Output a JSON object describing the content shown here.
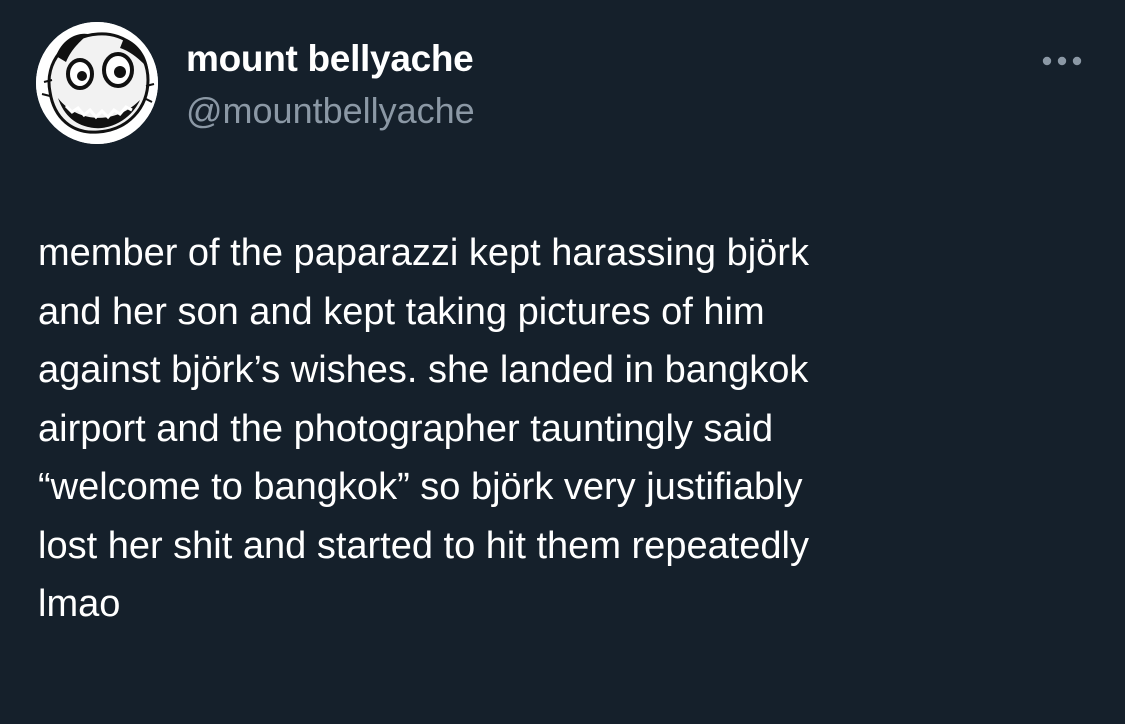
{
  "colors": {
    "background": "#15202b",
    "text_primary": "#ffffff",
    "text_secondary": "#8b98a5"
  },
  "author": {
    "avatar_icon": "cartoon-face-avatar",
    "display_name": "mount bellyache",
    "handle": "@mountbellyache"
  },
  "header": {
    "more_icon": "more-horizontal-icon"
  },
  "tweet": {
    "text_lines": [
      "member of the paparazzi kept harassing björk",
      "and her son and kept taking pictures of him",
      "against björk’s wishes. she landed in bangkok",
      "airport and the photographer tauntingly said",
      "“welcome to bangkok” so björk very justifiably",
      "lost her shit and started to hit them repeatedly",
      "lmao"
    ]
  }
}
